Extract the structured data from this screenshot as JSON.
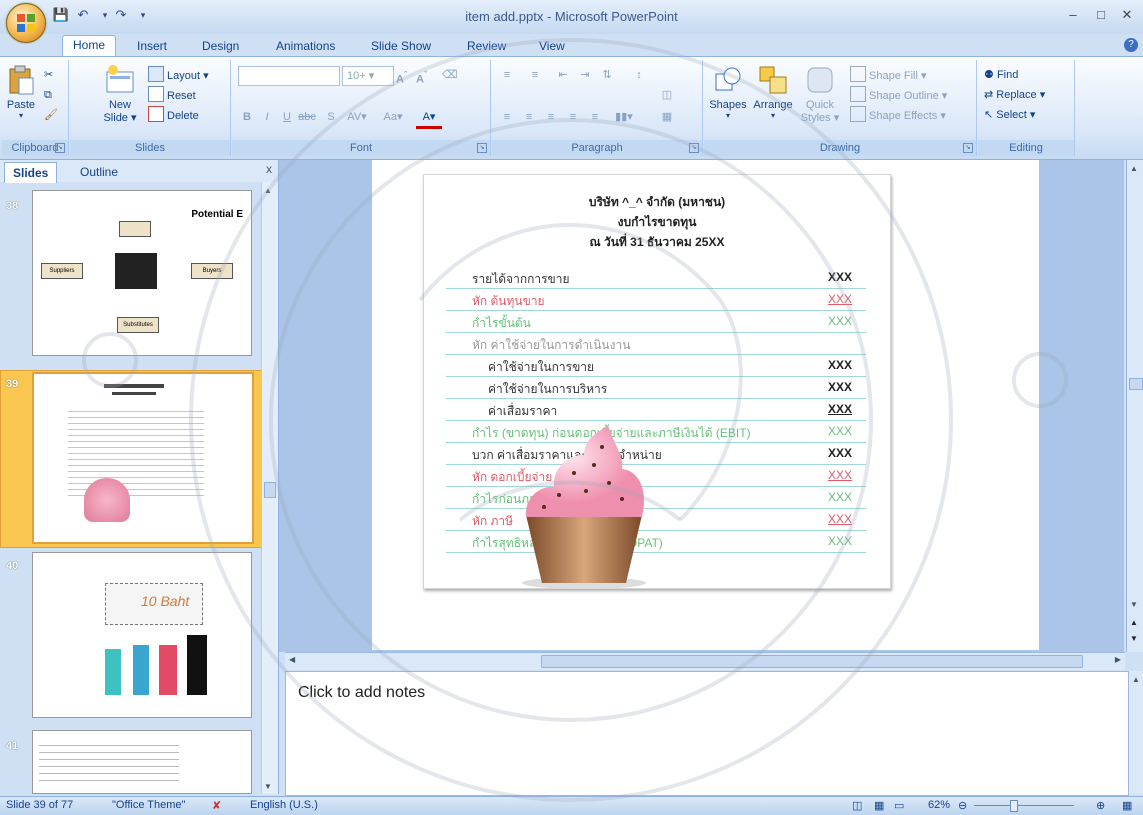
{
  "window": {
    "title": "item add.pptx - Microsoft PowerPoint"
  },
  "tabs": [
    "Home",
    "Insert",
    "Design",
    "Animations",
    "Slide Show",
    "Review",
    "View"
  ],
  "ribbon": {
    "clipboard": {
      "label": "Clipboard",
      "paste": "Paste"
    },
    "slides": {
      "label": "Slides",
      "new_slide": "New",
      "new_slide2": "Slide",
      "layout": "Layout",
      "reset": "Reset",
      "delete": "Delete"
    },
    "font": {
      "label": "Font",
      "size": "10+"
    },
    "paragraph": {
      "label": "Paragraph"
    },
    "drawing": {
      "label": "Drawing",
      "shapes": "Shapes",
      "arrange": "Arrange",
      "quick_styles": "Quick",
      "quick_styles2": "Styles",
      "shape_fill": "Shape Fill",
      "shape_outline": "Shape Outline",
      "shape_effects": "Shape Effects"
    },
    "editing": {
      "label": "Editing",
      "find": "Find",
      "replace": "Replace",
      "select": "Select"
    }
  },
  "left_pane": {
    "tabs": {
      "slides": "Slides",
      "outline": "Outline"
    },
    "thumbnails": [
      {
        "num": "38",
        "title": "Potential E",
        "labels": [
          "Suppliers",
          "Buyers",
          "Substitutes"
        ]
      },
      {
        "num": "39"
      },
      {
        "num": "40",
        "text": "10 Baht"
      },
      {
        "num": "41"
      }
    ]
  },
  "slide": {
    "heading": [
      "บริษัท ^_^ จำกัด (มหาชน)",
      "งบกำไรขาดทุน",
      "ณ วันที่ 31 ธันวาคม 25XX"
    ],
    "rows": [
      {
        "label": "รายได้จากการขาย",
        "value": "XXX",
        "style": "normal"
      },
      {
        "label": "หัก ต้นทุนขาย",
        "value": "XXX",
        "style": "red"
      },
      {
        "label": "กำไรขั้นต้น",
        "value": "XXX",
        "style": "green"
      },
      {
        "label": "หัก ค่าใช้จ่ายในการดำเนินงาน",
        "value": "",
        "style": "gray"
      },
      {
        "label": "ค่าใช้จ่ายในการขาย",
        "value": "XXX",
        "style": "indent"
      },
      {
        "label": "ค่าใช้จ่ายในการบริหาร",
        "value": "XXX",
        "style": "indent"
      },
      {
        "label": "ค่าเสื่อมราคา",
        "value": "XXX",
        "style": "indent-u"
      },
      {
        "label": "กำไร (ขาดทุน) ก่อนดอกเบี้ยจ่ายและภาษีเงินได้ (EBIT)",
        "value": "XXX",
        "style": "green"
      },
      {
        "label": "บวก ค่าเสื่อมราคาและค่าตัดจำหน่าย",
        "value": "XXX",
        "style": "normal"
      },
      {
        "label": "หัก ดอกเบี้ยจ่าย",
        "value": "XXX",
        "style": "red"
      },
      {
        "label": "กำไรก่อนภาษี (EBT)",
        "value": "XXX",
        "style": "green"
      },
      {
        "label": "หัก ภาษี",
        "value": "XXX",
        "style": "red"
      },
      {
        "label": "กำไรสุทธิหลังหักภาษีเงินได้ (NOPAT)",
        "value": "XXX",
        "style": "green"
      }
    ]
  },
  "notes": {
    "placeholder": "Click to add notes"
  },
  "status": {
    "slide": "Slide 39 of 77",
    "theme": "\"Office Theme\"",
    "language": "English (U.S.)",
    "zoom": "62%"
  }
}
